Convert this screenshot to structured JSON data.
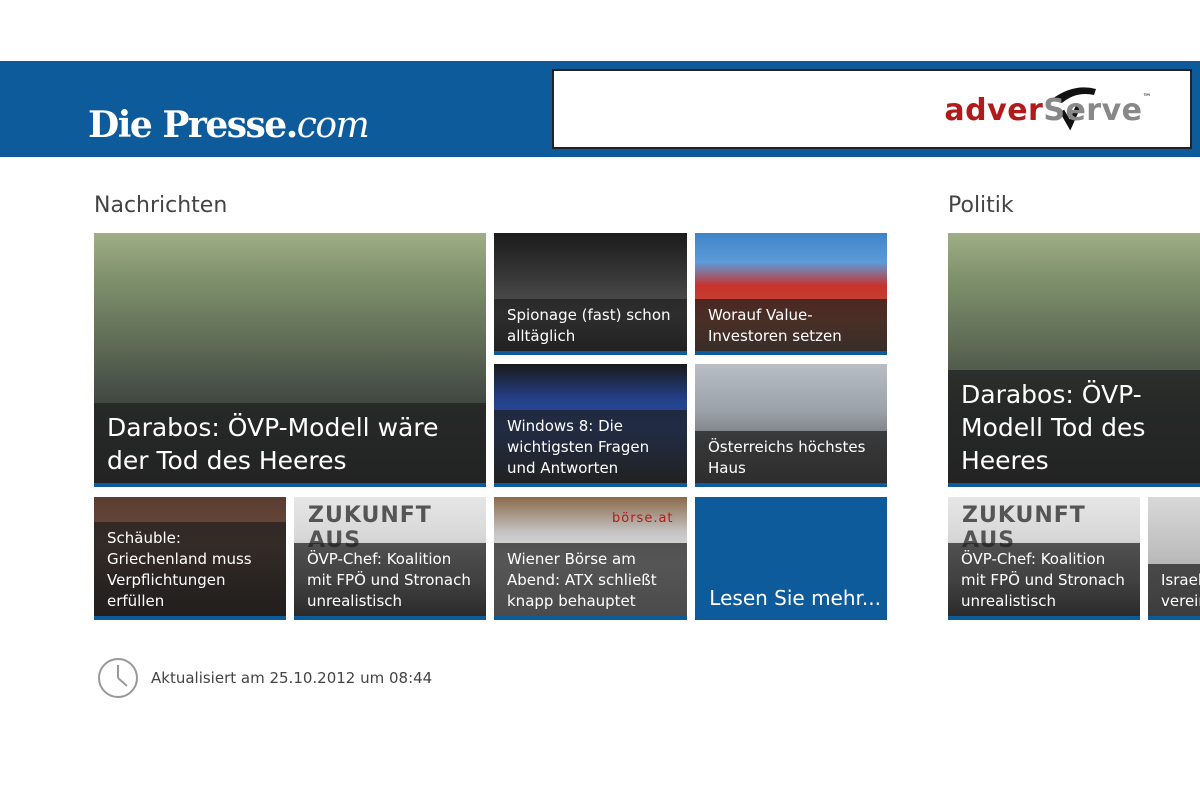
{
  "header": {
    "logo_main": "Die Presse",
    "logo_dot": ".",
    "logo_com": "com",
    "ad": {
      "part1": "adver",
      "part2": "Serve",
      "tm": "™"
    }
  },
  "sections": {
    "nachrichten": {
      "title": "Nachrichten"
    },
    "politik": {
      "title": "Politik"
    }
  },
  "tiles": {
    "darabos": "Darabos: ÖVP-Modell wäre der Tod des Heeres",
    "spionage": "Spionage (fast) schon alltäglich",
    "value": "Worauf Value-Investoren setzen",
    "windows": "Windows 8: Die wichtigsten Fragen und Antworten",
    "haus": "Österreichs höchstes Haus",
    "schaeuble": "Schäuble: Griechenland muss Verpflichtungen erfüllen",
    "oevp": "ÖVP-Chef: Koalition mit FPÖ und Stronach unrealistisch",
    "boerse": "Wiener Börse am Abend: ATX schließt knapp behauptet",
    "more": "Lesen Sie mehr...",
    "politik_darabos": "Darabos: ÖVP-Modell Tod des Heeres",
    "politik_oevp": "ÖVP-Chef: Koalition mit FPÖ und Stronach unrealistisch",
    "politik_partial": "Israel verein"
  },
  "image_text": {
    "zukunft": "ZUKUNFT AUS",
    "boerse_sign": "börse.at"
  },
  "footer": {
    "updated": "Aktualisiert am 25.10.2012 um 08:44"
  },
  "colors": {
    "brand_blue": "#0e5b9c",
    "ad_red": "#b31b1b"
  }
}
